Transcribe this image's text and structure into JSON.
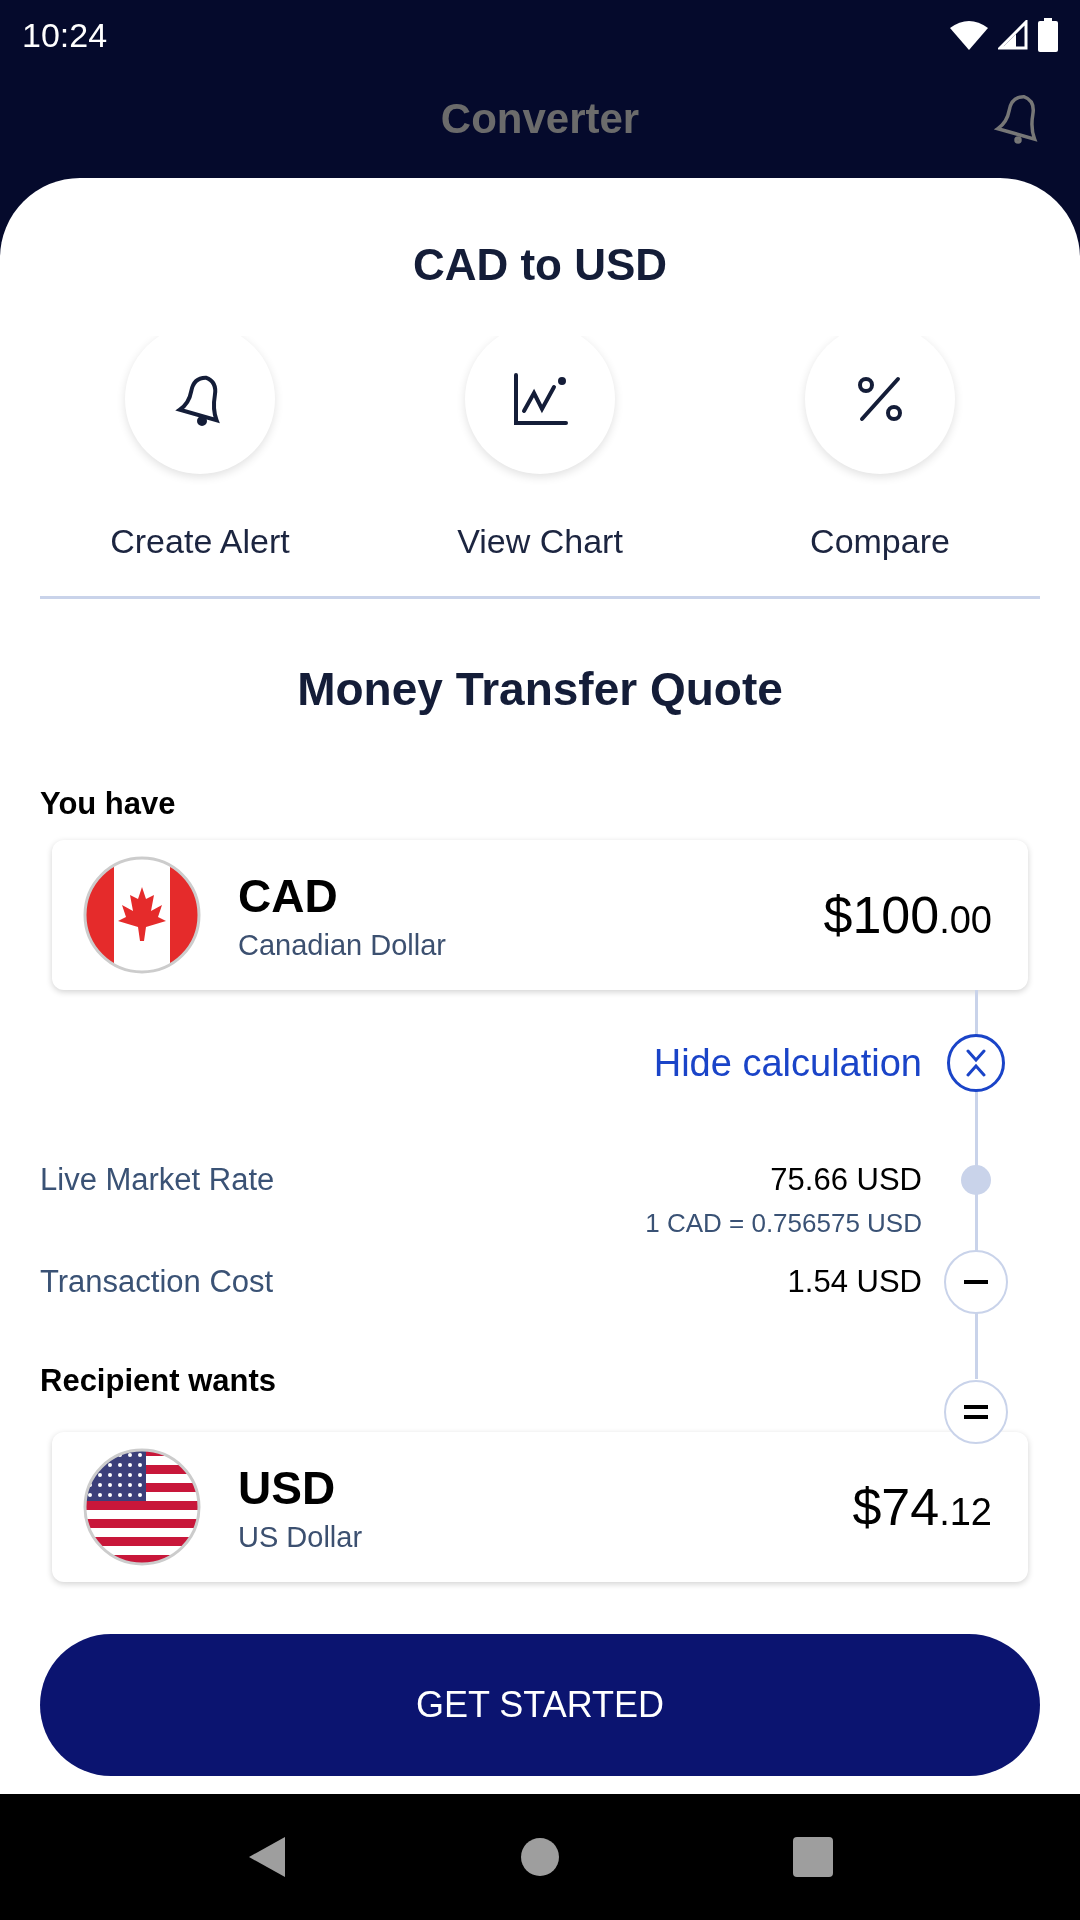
{
  "status_bar": {
    "time": "10:24"
  },
  "app_bar": {
    "title": "Converter"
  },
  "sheet": {
    "title": "CAD to USD"
  },
  "actions": [
    {
      "kind": "alert",
      "label": "Create Alert"
    },
    {
      "kind": "chart",
      "label": "View Chart"
    },
    {
      "kind": "compare",
      "label": "Compare"
    }
  ],
  "quote": {
    "title": "Money Transfer Quote",
    "source": {
      "label": "You have",
      "kind": "canada",
      "code": "CAD",
      "name": "Canadian Dollar",
      "amount": "$100",
      "cents": ".00"
    },
    "toggle": {
      "label": "Hide calculation",
      "expanded": true
    },
    "rows": [
      {
        "kind": "rate",
        "label": "Live Market Rate",
        "value": "75.66 USD",
        "note": "1 CAD = 0.756575 USD"
      },
      {
        "kind": "fee",
        "label": "Transaction Cost",
        "value": "1.54 USD"
      }
    ],
    "target": {
      "label": "Recipient wants",
      "kind": "usa",
      "code": "USD",
      "name": "US Dollar",
      "amount": "$74",
      "cents": ".12"
    }
  },
  "button": "GET STARTED"
}
